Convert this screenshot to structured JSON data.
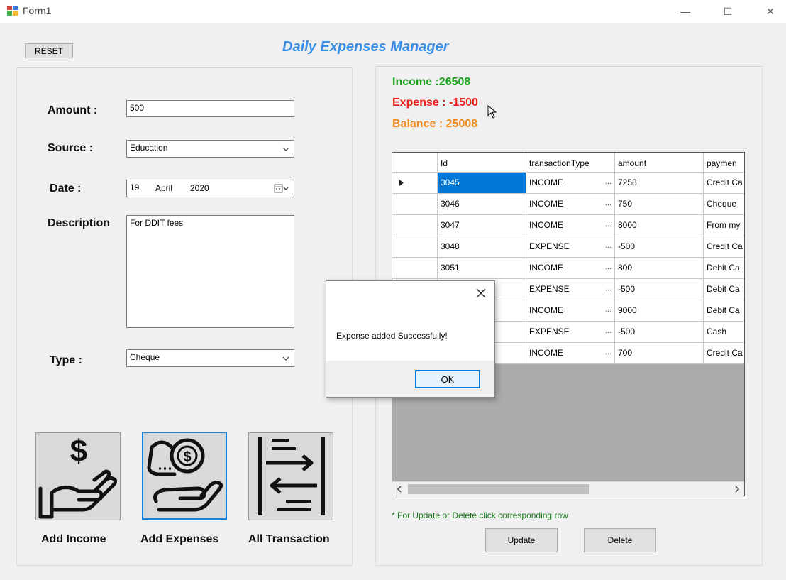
{
  "window": {
    "title": "Form1",
    "minimize_glyph": "—",
    "maximize_glyph": "☐",
    "close_glyph": "✕"
  },
  "header": {
    "reset_label": "RESET",
    "app_title": "Daily Expenses Manager"
  },
  "form": {
    "amount_label": "Amount :",
    "amount_value": "500",
    "source_label": "Source :",
    "source_value": "Education",
    "date_label": "Date :",
    "date_day": "19",
    "date_month": "April",
    "date_year": "2020",
    "description_label": "Description",
    "description_value": "For DDIT fees",
    "type_label": "Type :",
    "type_value": "Cheque"
  },
  "actions": {
    "add_income": "Add Income",
    "add_expenses": "Add Expenses",
    "all_transaction": "All Transaction"
  },
  "summary": {
    "income": "Income :26508",
    "expense": "Expense : -1500",
    "balance": "Balance : 25008",
    "income_color": "#1aa11a",
    "expense_color": "#e8201a",
    "balance_color": "#f08a1e"
  },
  "grid": {
    "columns": [
      "Id",
      "transactionType",
      "amount",
      "paymen"
    ],
    "rows": [
      {
        "id": "3045",
        "type": "INCOME",
        "amount": "7258",
        "payment": "Credit Ca"
      },
      {
        "id": "3046",
        "type": "INCOME",
        "amount": "750",
        "payment": "Cheque"
      },
      {
        "id": "3047",
        "type": "INCOME",
        "amount": "8000",
        "payment": "From my"
      },
      {
        "id": "3048",
        "type": "EXPENSE",
        "amount": "-500",
        "payment": "Credit Ca"
      },
      {
        "id": "3051",
        "type": "INCOME",
        "amount": "800",
        "payment": "Debit Ca"
      },
      {
        "id": "",
        "type": "EXPENSE",
        "amount": "-500",
        "payment": "Debit Ca"
      },
      {
        "id": "",
        "type": "INCOME",
        "amount": "9000",
        "payment": "Debit Ca"
      },
      {
        "id": "",
        "type": "EXPENSE",
        "amount": "-500",
        "payment": "Cash"
      },
      {
        "id": "",
        "type": "INCOME",
        "amount": "700",
        "payment": "Credit Ca"
      }
    ],
    "ellipsis": "...",
    "note": "* For Update or Delete click corresponding row",
    "update_label": "Update",
    "delete_label": "Delete"
  },
  "dialog": {
    "message": "Expense added Successfully!",
    "ok_label": "OK"
  }
}
